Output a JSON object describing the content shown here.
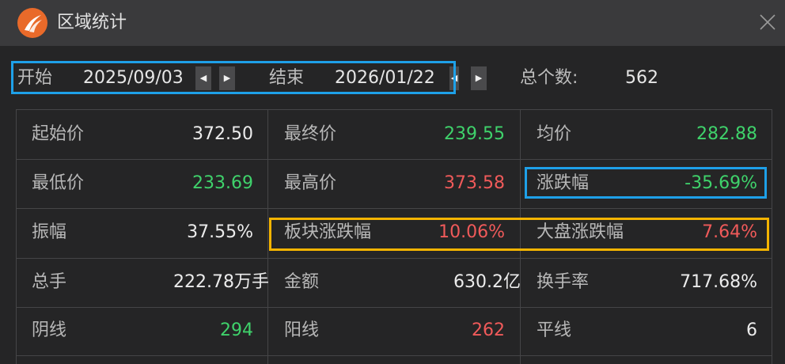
{
  "window": {
    "title": "区域统计"
  },
  "toolbar": {
    "start_label": "开始",
    "start_value": "2025/09/03",
    "end_label": "结束",
    "end_value": "2026/01/22",
    "count_label": "总个数:",
    "count_value": "562"
  },
  "stats": {
    "rows": [
      [
        {
          "label": "起始价",
          "value": "372.50",
          "color": "white"
        },
        {
          "label": "最终价",
          "value": "239.55",
          "color": "green"
        },
        {
          "label": "均价",
          "value": "282.88",
          "color": "green"
        }
      ],
      [
        {
          "label": "最低价",
          "value": "233.69",
          "color": "green"
        },
        {
          "label": "最高价",
          "value": "373.58",
          "color": "red"
        },
        {
          "label": "涨跌幅",
          "value": "-35.69%",
          "color": "green"
        }
      ],
      [
        {
          "label": "振幅",
          "value": "37.55%",
          "color": "white"
        },
        {
          "label": "板块涨跌幅",
          "value": "10.06%",
          "color": "red"
        },
        {
          "label": "大盘涨跌幅",
          "value": "7.64%",
          "color": "red"
        }
      ],
      [
        {
          "label": "总手",
          "value": "222.78万手",
          "color": "white"
        },
        {
          "label": "金额",
          "value": "630.2亿",
          "color": "white"
        },
        {
          "label": "换手率",
          "value": "717.68%",
          "color": "white"
        }
      ],
      [
        {
          "label": "阴线",
          "value": "294",
          "color": "green"
        },
        {
          "label": "阳线",
          "value": "262",
          "color": "red"
        },
        {
          "label": "平线",
          "value": "6",
          "color": "white"
        }
      ]
    ]
  },
  "colors": {
    "up": "#f05a5a",
    "down": "#3fd26b",
    "neutral": "#ececec",
    "highlight_blue": "#1ea0e8",
    "highlight_yellow": "#f4b400"
  }
}
